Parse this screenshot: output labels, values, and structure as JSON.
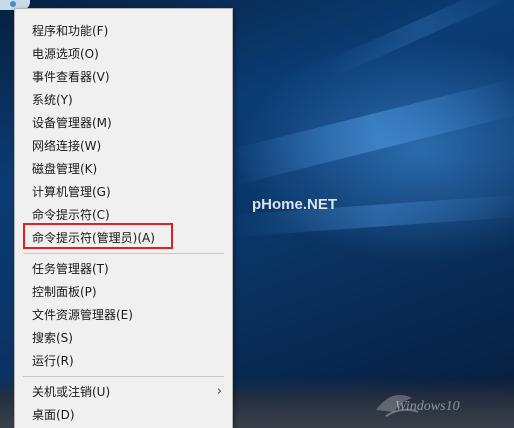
{
  "desktop": {
    "watermark": "pHome.NET",
    "logo_text": "Windows10"
  },
  "menu": {
    "groups": [
      [
        {
          "label": "程序和功能(F)",
          "has_submenu": false
        },
        {
          "label": "电源选项(O)",
          "has_submenu": false
        },
        {
          "label": "事件查看器(V)",
          "has_submenu": false
        },
        {
          "label": "系统(Y)",
          "has_submenu": false
        },
        {
          "label": "设备管理器(M)",
          "has_submenu": false
        },
        {
          "label": "网络连接(W)",
          "has_submenu": false
        },
        {
          "label": "磁盘管理(K)",
          "has_submenu": false
        },
        {
          "label": "计算机管理(G)",
          "has_submenu": false
        },
        {
          "label": "命令提示符(C)",
          "has_submenu": false
        },
        {
          "label": "命令提示符(管理员)(A)",
          "has_submenu": false,
          "highlighted": true
        }
      ],
      [
        {
          "label": "任务管理器(T)",
          "has_submenu": false
        },
        {
          "label": "控制面板(P)",
          "has_submenu": false
        },
        {
          "label": "文件资源管理器(E)",
          "has_submenu": false
        },
        {
          "label": "搜索(S)",
          "has_submenu": false
        },
        {
          "label": "运行(R)",
          "has_submenu": false
        }
      ],
      [
        {
          "label": "关机或注销(U)",
          "has_submenu": true,
          "submenu_icon": "chevron-right-icon"
        },
        {
          "label": "桌面(D)",
          "has_submenu": false
        }
      ]
    ]
  },
  "colors": {
    "menu_bg": "#f0f0f0",
    "highlight_border": "#e02020",
    "desktop_blue": "#0b3c74"
  }
}
